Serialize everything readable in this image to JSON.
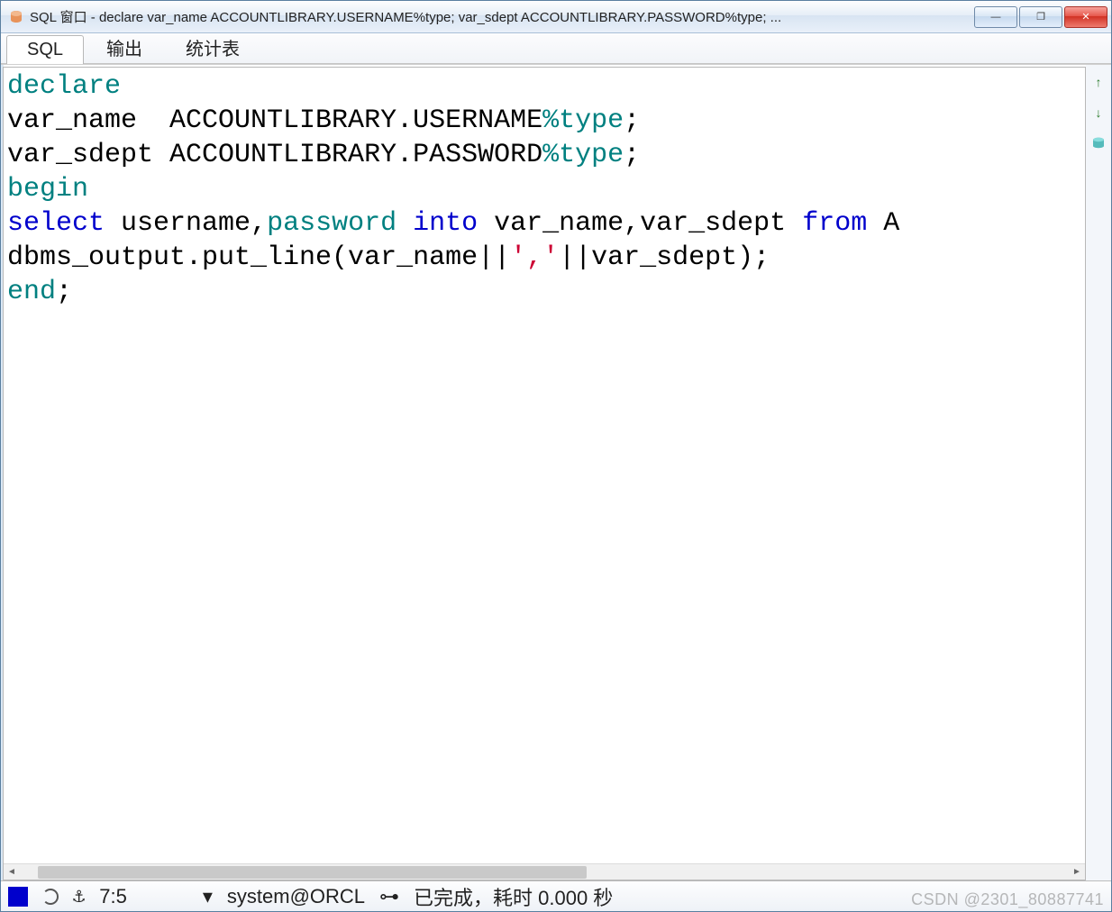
{
  "window": {
    "title": "SQL 窗口 - declare var_name ACCOUNTLIBRARY.USERNAME%type; var_sdept ACCOUNTLIBRARY.PASSWORD%type; ...",
    "controls": {
      "minimize": "—",
      "maximize": "❐",
      "close": "✕"
    }
  },
  "tabs": [
    {
      "label": "SQL",
      "underline": "S",
      "active": true
    },
    {
      "label": "输出",
      "underline": "",
      "active": false
    },
    {
      "label": "统计表",
      "underline": "",
      "active": false
    }
  ],
  "code": {
    "tokens": [
      [
        {
          "t": "declare",
          "c": "kw-teal"
        }
      ],
      [
        {
          "t": "var_name  ACCOUNTLIBRARY.USERNAME",
          "c": ""
        },
        {
          "t": "%type",
          "c": "kw-teal"
        },
        {
          "t": ";",
          "c": ""
        }
      ],
      [
        {
          "t": "var_sdept ACCOUNTLIBRARY.PASSWORD",
          "c": ""
        },
        {
          "t": "%type",
          "c": "kw-teal"
        },
        {
          "t": ";",
          "c": ""
        }
      ],
      [
        {
          "t": "begin",
          "c": "kw-teal"
        }
      ],
      [
        {
          "t": "select",
          "c": "kw-blue"
        },
        {
          "t": " username,",
          "c": ""
        },
        {
          "t": "password",
          "c": "kw-teal"
        },
        {
          "t": " ",
          "c": ""
        },
        {
          "t": "into",
          "c": "kw-blue"
        },
        {
          "t": " var_name,var_sdept ",
          "c": ""
        },
        {
          "t": "from",
          "c": "kw-blue"
        },
        {
          "t": " A",
          "c": ""
        }
      ],
      [
        {
          "t": "dbms_output.put_line(var_name||",
          "c": ""
        },
        {
          "t": "','",
          "c": "kw-red"
        },
        {
          "t": "||var_sdept);",
          "c": ""
        }
      ],
      [
        {
          "t": "end",
          "c": "kw-teal"
        },
        {
          "t": ";",
          "c": ""
        }
      ]
    ]
  },
  "side_tools": {
    "up": "↑",
    "down": "↓",
    "exec": "execute-icon"
  },
  "status": {
    "anchor_glyph": "⚓",
    "cursor": "7:5",
    "user_glyph": "▾",
    "connection": "system@ORCL",
    "pin_glyph": "⊶",
    "message": "已完成，耗时 0.000 秒"
  },
  "watermark": "CSDN @2301_80887741"
}
